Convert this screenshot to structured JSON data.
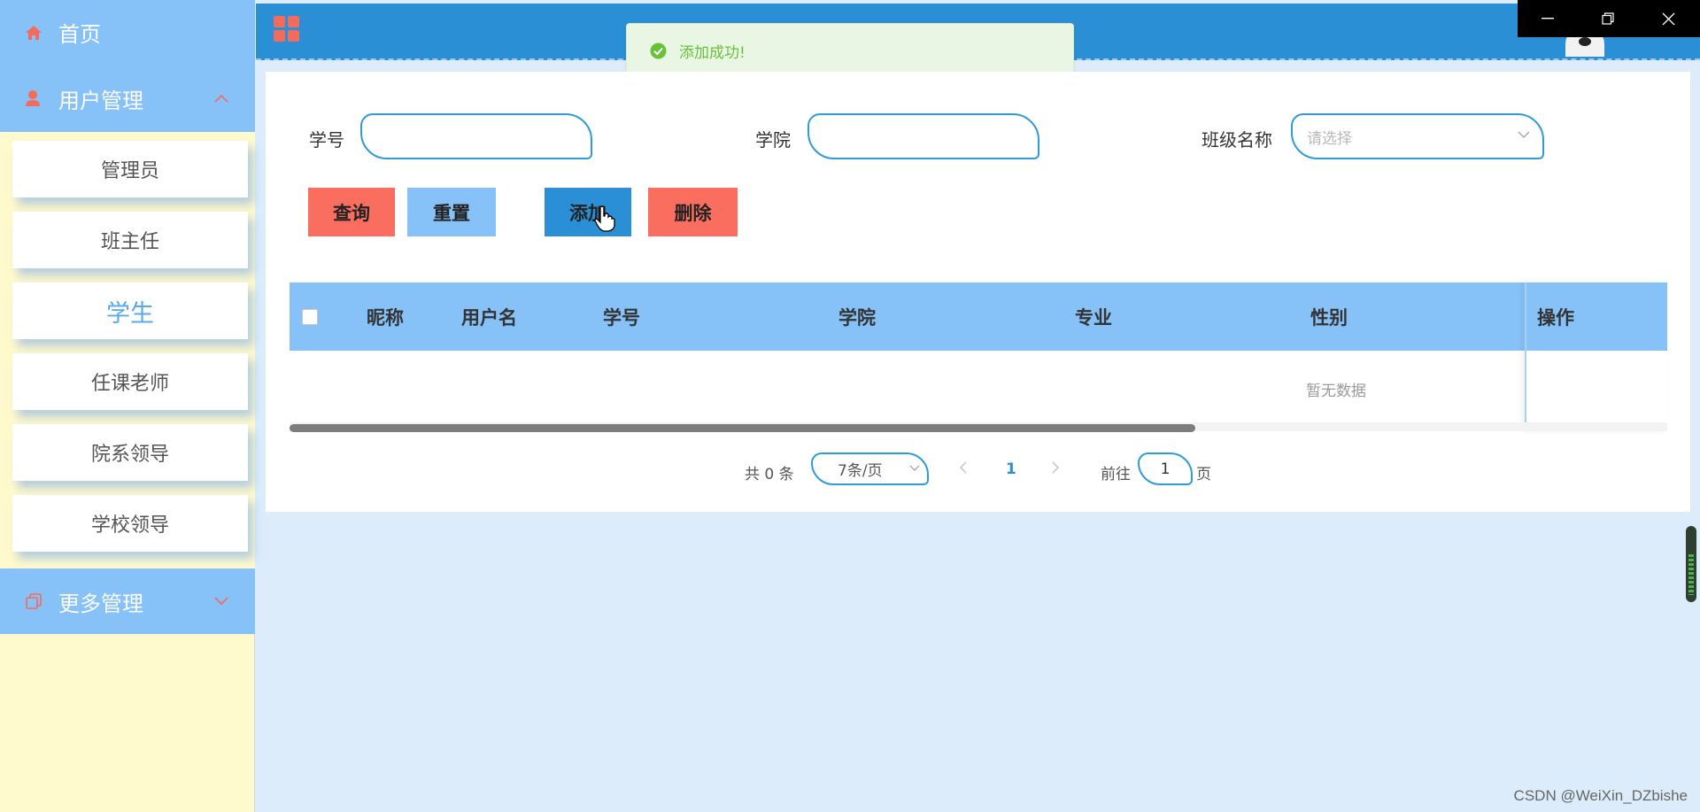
{
  "sidebar": {
    "home": "首页",
    "user_management": "用户管理",
    "items": [
      {
        "label": "管理员"
      },
      {
        "label": "班主任"
      },
      {
        "label": "学生"
      },
      {
        "label": "任课老师"
      },
      {
        "label": "院系领导"
      },
      {
        "label": "学校领导"
      }
    ],
    "more_management": "更多管理"
  },
  "toast": {
    "message": "添加成功!"
  },
  "filters": {
    "student_no_label": "学号",
    "college_label": "学院",
    "class_label": "班级名称",
    "class_placeholder": "请选择"
  },
  "buttons": {
    "query": "查询",
    "reset": "重置",
    "add": "添加",
    "delete": "删除"
  },
  "table": {
    "columns": [
      "昵称",
      "用户名",
      "学号",
      "学院",
      "专业",
      "性别",
      "操作"
    ],
    "empty_text": "暂无数据"
  },
  "pagination": {
    "total": "共 0 条",
    "page_size": "7条/页",
    "current_page": "1",
    "goto_label": "前往",
    "goto_value": "1",
    "page_unit": "页"
  },
  "watermark": "CSDN @WeiXin_DZbishe",
  "colors": {
    "sidebar_blue": "#86c1f7",
    "header_blue": "#2a8fd4",
    "accent_red": "#fa6e5f",
    "sidebar_bg": "#fffacd",
    "success_green": "#67c23a"
  }
}
